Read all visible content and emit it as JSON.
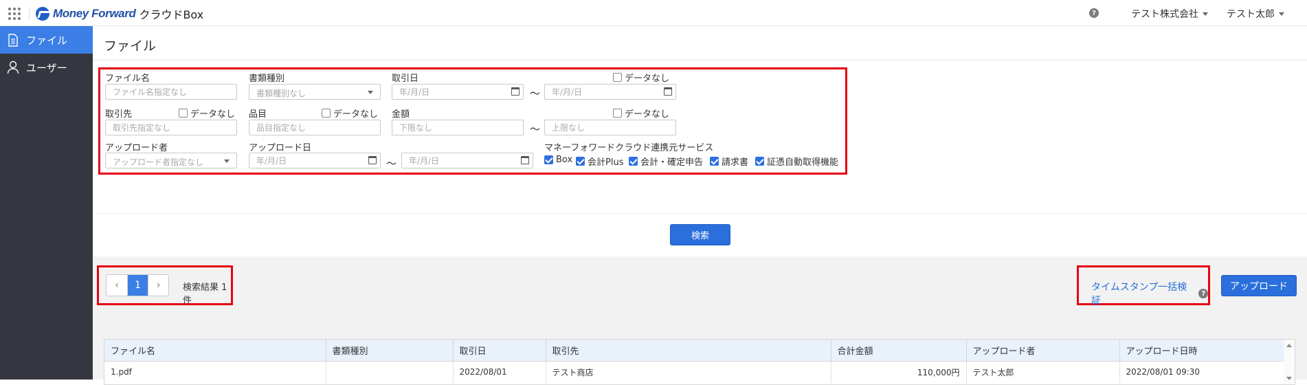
{
  "app": {
    "brand": "Money Forward",
    "product": "クラウドBox"
  },
  "header": {
    "company": "テスト株式会社",
    "user": "テスト太郎",
    "help_icon": "question-circle-icon",
    "apps_icon": "grid-dots-icon"
  },
  "sidebar": {
    "items": [
      {
        "label": "ファイル",
        "icon": "document-icon",
        "active": true
      },
      {
        "label": "ユーザー",
        "icon": "user-icon",
        "active": false
      }
    ]
  },
  "page": {
    "title": "ファイル"
  },
  "filters": {
    "file_name": {
      "label": "ファイル名",
      "placeholder": "ファイル名指定なし"
    },
    "doc_type": {
      "label": "書類種別",
      "placeholder": "書類種別なし"
    },
    "trade_date": {
      "label": "取引日",
      "from_placeholder": "年/月/日",
      "to_placeholder": "年/月/日",
      "no_data_label": "データなし"
    },
    "partner": {
      "label": "取引先",
      "placeholder": "取引先指定なし",
      "no_data_label": "データなし"
    },
    "item": {
      "label": "品目",
      "placeholder": "品目指定なし",
      "no_data_label": "データなし"
    },
    "amount": {
      "label": "金額",
      "min_placeholder": "下限なし",
      "max_placeholder": "上限なし",
      "no_data_label": "データなし"
    },
    "uploader": {
      "label": "アップロード者",
      "placeholder": "アップロード者指定なし"
    },
    "upload_date": {
      "label": "アップロード日",
      "from_placeholder": "年/月/日",
      "to_placeholder": "年/月/日"
    },
    "services": {
      "label": "マネーフォワードクラウド連携元サービス",
      "options": [
        {
          "label": "Box",
          "checked": true
        },
        {
          "label": "会計Plus",
          "checked": true
        },
        {
          "label": "会計・確定申告",
          "checked": true
        },
        {
          "label": "請求書",
          "checked": true
        },
        {
          "label": "証憑自動取得機能",
          "checked": true
        }
      ]
    },
    "range_sep": "～",
    "search_label": "検索"
  },
  "results": {
    "pager": {
      "prev": "‹",
      "current": "1",
      "next": "›"
    },
    "count_text": "検索結果 1件",
    "timestamp_link": "タイムスタンプ一括検証",
    "upload_label": "アップロード",
    "columns": [
      "ファイル名",
      "書類種別",
      "取引日",
      "取引先",
      "合計金額",
      "アップロード者",
      "アップロード日時"
    ],
    "rows": [
      [
        "1.pdf",
        "",
        "2022/08/01",
        "テスト商店",
        "110,000円",
        "テスト太郎",
        "2022/08/01 09:30"
      ]
    ]
  }
}
